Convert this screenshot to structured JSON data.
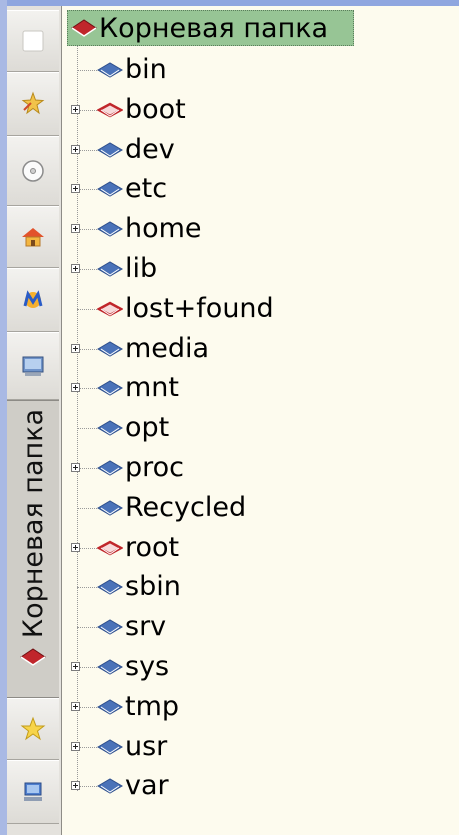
{
  "sidebar": {
    "active_tab_label": "Корневая папка",
    "tabs": [
      {
        "icon": "blank-page-icon"
      },
      {
        "icon": "sparkle-folder-icon"
      },
      {
        "icon": "disk-icon"
      },
      {
        "icon": "home-icon"
      },
      {
        "icon": "network-m-icon"
      },
      {
        "icon": "computer-screen-icon"
      },
      {
        "icon": "root-folder-icon"
      },
      {
        "icon": "star-icon"
      },
      {
        "icon": "monitor-icon"
      }
    ]
  },
  "tree": {
    "root_label": "Корневая папка",
    "items": [
      {
        "label": "bin",
        "expandable": false,
        "locked": false
      },
      {
        "label": "boot",
        "expandable": true,
        "locked": true
      },
      {
        "label": "dev",
        "expandable": true,
        "locked": false
      },
      {
        "label": "etc",
        "expandable": true,
        "locked": false
      },
      {
        "label": "home",
        "expandable": true,
        "locked": false
      },
      {
        "label": "lib",
        "expandable": true,
        "locked": false
      },
      {
        "label": "lost+found",
        "expandable": false,
        "locked": true
      },
      {
        "label": "media",
        "expandable": true,
        "locked": false
      },
      {
        "label": "mnt",
        "expandable": true,
        "locked": false
      },
      {
        "label": "opt",
        "expandable": false,
        "locked": false
      },
      {
        "label": "proc",
        "expandable": true,
        "locked": false
      },
      {
        "label": "Recycled",
        "expandable": false,
        "locked": false
      },
      {
        "label": "root",
        "expandable": true,
        "locked": true
      },
      {
        "label": "sbin",
        "expandable": false,
        "locked": false
      },
      {
        "label": "srv",
        "expandable": false,
        "locked": false
      },
      {
        "label": "sys",
        "expandable": true,
        "locked": false
      },
      {
        "label": "tmp",
        "expandable": true,
        "locked": false
      },
      {
        "label": "usr",
        "expandable": true,
        "locked": false
      },
      {
        "label": "var",
        "expandable": true,
        "locked": false
      }
    ]
  },
  "colors": {
    "folder_blue": "#4a72b8",
    "folder_red": "#c0262b",
    "selection": "#97c595",
    "panel_bg": "#fdfbee"
  }
}
